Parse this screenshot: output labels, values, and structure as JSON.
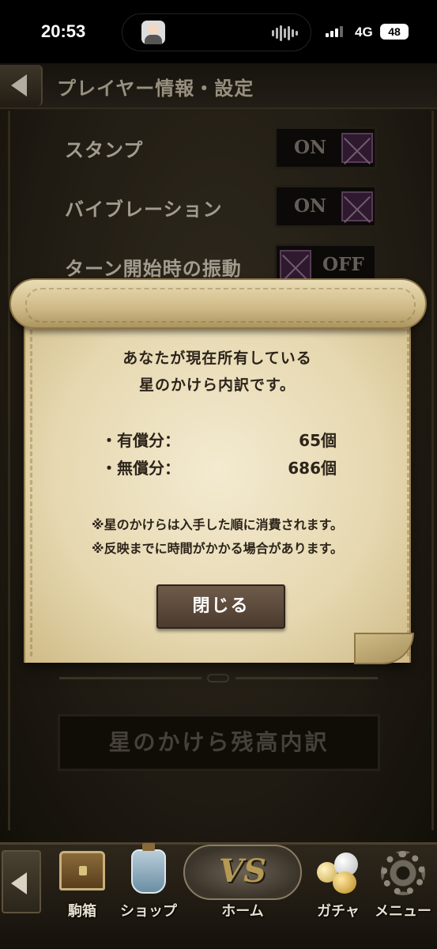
{
  "status_bar": {
    "time": "20:53",
    "network": "4G",
    "battery": "48"
  },
  "header": {
    "title": "プレイヤー情報・設定"
  },
  "settings": [
    {
      "label": "スタンプ",
      "toggle": "ON",
      "on": true
    },
    {
      "label": "バイブレーション",
      "toggle": "ON",
      "on": true
    },
    {
      "label": "ターン開始時の振動",
      "toggle": "OFF",
      "on": false
    }
  ],
  "balance_button": {
    "label": "星のかけら残高内訳"
  },
  "dialog": {
    "message_line1": "あなたが現在所有している",
    "message_line2": "星のかけら内訳です。",
    "rows": [
      {
        "label": "・有償分：",
        "value": "65個"
      },
      {
        "label": "・無償分：",
        "value": "686個"
      }
    ],
    "note1": "※星のかけらは入手した順に消費されます。",
    "note2": "※反映までに時間がかかる場合があります。",
    "close_label": "閉じる"
  },
  "bottom_nav": {
    "items": [
      {
        "label": "駒箱",
        "icon": "chest-icon"
      },
      {
        "label": "ショップ",
        "icon": "shop-bottle-icon"
      },
      {
        "label": "ホーム",
        "icon": "vs-icon",
        "badge": "VS"
      },
      {
        "label": "ガチャ",
        "icon": "gacha-orbs-icon"
      },
      {
        "label": "メニュー",
        "icon": "gear-icon"
      }
    ]
  }
}
